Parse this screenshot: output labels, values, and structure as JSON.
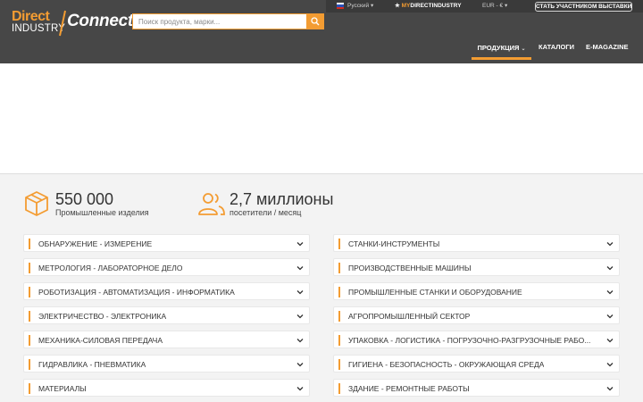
{
  "header": {
    "logo": {
      "line1": "Direct",
      "line2": "INDUSTRY",
      "line3": "Connect"
    },
    "search": {
      "placeholder": "Поиск продукта, марки...",
      "value": ""
    },
    "topbar": {
      "language": "Русский",
      "my_prefix": "MY",
      "my_suffix": "DIRECTINDUSTRY",
      "currency": "EUR - €",
      "exhibitor_button": "СТАТЬ УЧАСТНИКОМ ВЫСТАВКИ"
    },
    "nav": {
      "products": "ПРОДУКЦИЯ",
      "catalogs": "КАТАЛОГИ",
      "emagazine": "E-MAGAZINE"
    }
  },
  "stats": [
    {
      "number": "550 000",
      "label": "Промышленные изделия",
      "icon": "box-icon"
    },
    {
      "number": "2,7 миллионы",
      "label": "посетители / месяц",
      "icon": "users-icon"
    }
  ],
  "categories_left": [
    "ОБНАРУЖЕНИЕ - ИЗМЕРЕНИЕ",
    "МЕТРОЛОГИЯ - ЛАБОРАТОРНОЕ ДЕЛО",
    "РОБОТИЗАЦИЯ - АВТОМАТИЗАЦИЯ - ИНФОРМАТИКА",
    "ЭЛЕКТРИЧЕСТВО - ЭЛЕКТРОНИКА",
    "МЕХАНИКА-СИЛОВАЯ ПЕРЕДАЧА",
    "ГИДРАВЛИКА - ПНЕВМАТИКА",
    "МАТЕРИАЛЫ"
  ],
  "categories_right": [
    "СТАНКИ-ИНСТРУМЕНТЫ",
    "ПРОИЗВОДСТВЕННЫЕ МАШИНЫ",
    "ПРОМЫШЛЕННЫЕ СТАНКИ И ОБОРУДОВАНИЕ",
    "АГРОПРОМЫШЛЕННЫЙ СЕКТОР",
    "УПАКОВКА - ЛОГИСТИКА - ПОГРУЗОЧНО-РАЗГРУЗОЧНЫЕ РАБО...",
    "ГИГИЕНА - БЕЗОПАСНОСТЬ - ОКРУЖАЮЩАЯ СРЕДА",
    "ЗДАНИЕ - РЕМОНТНЫЕ РАБОТЫ"
  ],
  "colors": {
    "accent": "#f39c32",
    "header": "#474747",
    "topbar": "#3a3a3a"
  }
}
